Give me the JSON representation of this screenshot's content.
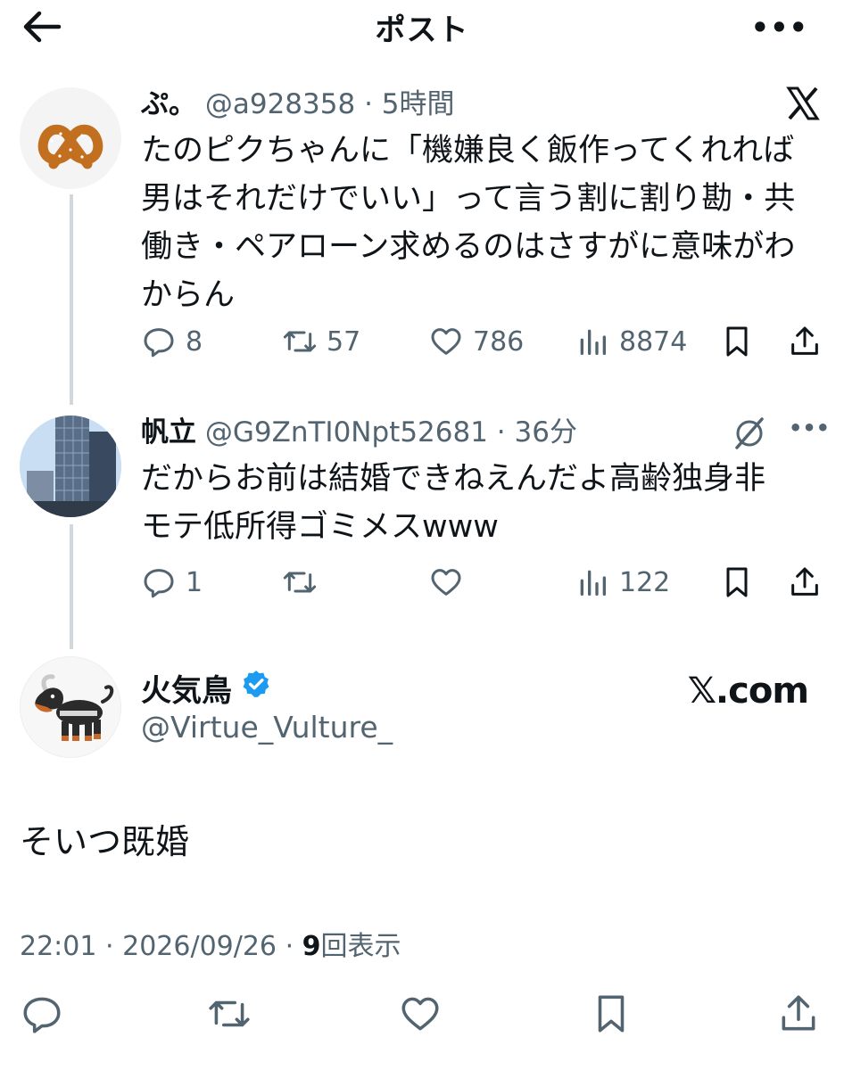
{
  "header": {
    "title": "ポスト"
  },
  "tweets": [
    {
      "name": "ぷ。",
      "handle": "@a928358",
      "time_sep": "·",
      "time": "5時間",
      "body_lines": [
        "たのピクちゃんに「機嫌良く飯作ってくれれば",
        "男はそれだけでいい」って言う割に割り勘・共",
        "働き・ペアローン求めるのはさすがに意味がわ",
        "からん"
      ],
      "corner_icon": "x-logo-icon",
      "stats": {
        "replies": "8",
        "reposts": "57",
        "likes": "786",
        "views": "8874"
      }
    },
    {
      "name": "帆立",
      "handle": "@G9ZnTI0Npt52681",
      "time_sep": "·",
      "time": "36分",
      "body_lines": [
        "だからお前は結婚できねえんだよ高齢独身非",
        "モテ低所得ゴミメスwww"
      ],
      "corner_icon": "grok-icon",
      "stats": {
        "replies": "1",
        "reposts": "",
        "likes": "",
        "views": "122"
      }
    }
  ],
  "main_post": {
    "name": "火気鳥",
    "handle": "@Virtue_Vulture_",
    "verified": true,
    "brand": "𝕏.com",
    "text": "そいつ既婚",
    "time": "22:01",
    "date": "2026/09/26",
    "sep": "·",
    "views_count": "9",
    "views_label": "回表示"
  },
  "colors": {
    "text": "#0f1419",
    "muted": "#536471",
    "thread": "#cfd9de",
    "verified": "#1d9bf0"
  }
}
